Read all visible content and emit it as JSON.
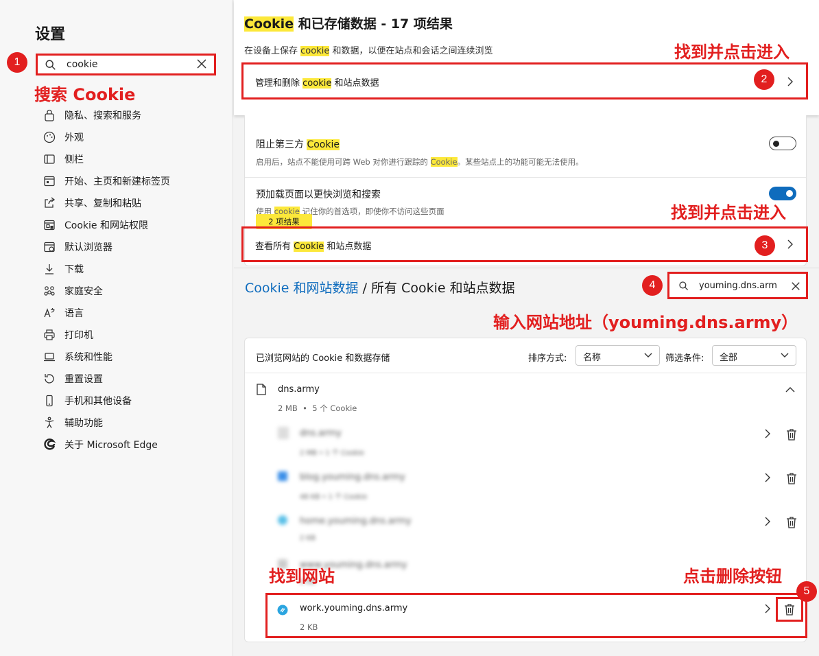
{
  "sidebar": {
    "title": "设置",
    "search_value": "cookie",
    "items": [
      {
        "label": "隐私、搜索和服务",
        "icon": "lock-icon"
      },
      {
        "label": "外观",
        "icon": "palette-icon"
      },
      {
        "label": "侧栏",
        "icon": "sidebar-icon"
      },
      {
        "label": "开始、主页和新建标签页",
        "icon": "home-icon"
      },
      {
        "label": "共享、复制和粘贴",
        "icon": "share-icon"
      },
      {
        "label": "Cookie 和网站权限",
        "icon": "site-permissions-icon"
      },
      {
        "label": "默认浏览器",
        "icon": "browser-icon"
      },
      {
        "label": "下载",
        "icon": "download-icon"
      },
      {
        "label": "家庭安全",
        "icon": "family-icon"
      },
      {
        "label": "语言",
        "icon": "language-icon"
      },
      {
        "label": "打印机",
        "icon": "printer-icon"
      },
      {
        "label": "系统和性能",
        "icon": "laptop-icon"
      },
      {
        "label": "重置设置",
        "icon": "reset-icon"
      },
      {
        "label": "手机和其他设备",
        "icon": "phone-icon"
      },
      {
        "label": "辅助功能",
        "icon": "accessibility-icon"
      },
      {
        "label": "关于 Microsoft Edge",
        "icon": "edge-icon"
      }
    ]
  },
  "annotations": {
    "a1": "搜索 Cookie",
    "a2": "找到并点击进入",
    "a3": "找到并点击进入",
    "a4": "输入网站地址（youming.dns.army）",
    "a_site": "找到网站",
    "a5": "点击删除按钮",
    "n1": "1",
    "n2": "2",
    "n3": "3",
    "n4": "4",
    "n5": "5"
  },
  "top_panel": {
    "title_hl": "Cookie",
    "title_rest": " 和已存储数据 - 17 项结果",
    "desc_a": "在设备上保存 ",
    "desc_hl": "cookie",
    "desc_b": " 和数据，以便在站点和会话之间连续浏览",
    "manage_a": "管理和删除 ",
    "manage_hl": "cookie",
    "manage_b": " 和站点数据"
  },
  "mid_panel": {
    "block_a": "阻止第三方 ",
    "block_hl": "Cookie",
    "block_desc_a": "启用后，站点不能使用可跨 Web 对你进行跟踪的 ",
    "block_desc_hl": "Cookie",
    "block_desc_b": "。某些站点上的功能可能无法使用。",
    "preload_title": "预加载页面以更快浏览和搜索",
    "preload_desc_a": "使用 ",
    "preload_desc_hl": "cookie",
    "preload_desc_b": " 记住你的首选项，即使你不访问这些页面",
    "tooltip": "2 项结果",
    "viewall_a": "查看所有 ",
    "viewall_hl": "Cookie",
    "viewall_b": " 和站点数据",
    "block_toggle": false,
    "preload_toggle": true
  },
  "breadcrumb": {
    "link": "Cookie 和网站数据",
    "sep": " / ",
    "current": "所有 Cookie 和站点数据"
  },
  "site_search": {
    "value": "youming.dns.arm"
  },
  "list_panel": {
    "header": "已浏览网站的 Cookie 和数据存储",
    "sort_label": "排序方式:",
    "sort_value": "名称",
    "filter_label": "筛选条件:",
    "filter_value": "全部",
    "group": {
      "domain": "dns.army",
      "meta_size": "2 MB",
      "meta_dot": "•",
      "meta_count": "5 个 Cookie"
    },
    "blurred": [
      {
        "name": "dns.army",
        "meta": "2 MB • 1 个 Cookie"
      },
      {
        "name": "blog.youming.dns.army",
        "meta": "48 KB • 1 个 Cookie"
      },
      {
        "name": "home.youming.dns.army",
        "meta": "2 KB"
      },
      {
        "name": "www.youming.dns.army",
        "meta": "2 KB"
      }
    ],
    "target": {
      "name": "work.youming.dns.army",
      "meta": "2 KB"
    }
  }
}
